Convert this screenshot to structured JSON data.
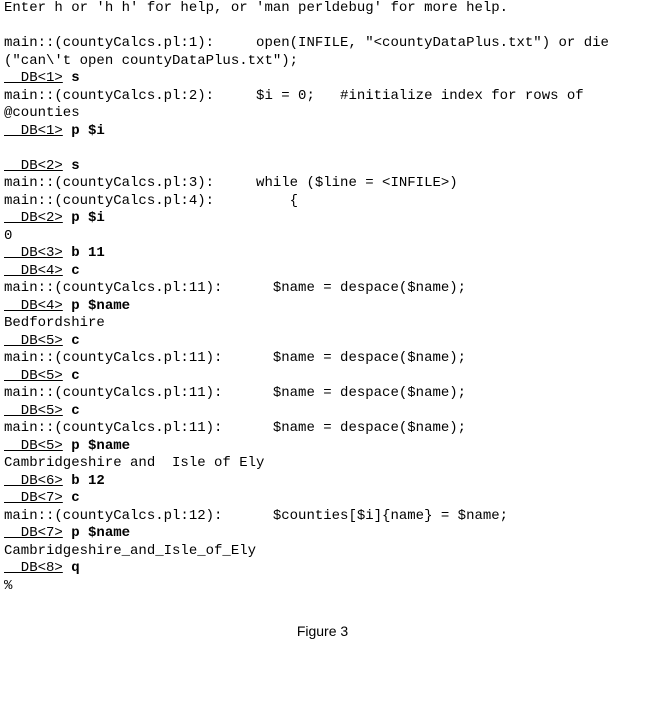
{
  "lines": [
    [
      {
        "t": "plain",
        "v": "Enter h or 'h h' for help, or 'man perldebug' for more help."
      }
    ],
    [
      {
        "t": "plain",
        "v": ""
      }
    ],
    [
      {
        "t": "plain",
        "v": "main::(countyCalcs.pl:1):     open(INFILE, \"<countyDataPlus.txt\") or die"
      }
    ],
    [
      {
        "t": "plain",
        "v": "(\"can\\'t open countyDataPlus.txt\");"
      }
    ],
    [
      {
        "t": "db",
        "v": "  DB<1>"
      },
      {
        "t": "plain",
        "v": " "
      },
      {
        "t": "cmd",
        "v": "s"
      }
    ],
    [
      {
        "t": "plain",
        "v": "main::(countyCalcs.pl:2):     $i = 0;   #initialize index for rows of"
      }
    ],
    [
      {
        "t": "plain",
        "v": "@counties"
      }
    ],
    [
      {
        "t": "db",
        "v": "  DB<1>"
      },
      {
        "t": "plain",
        "v": " "
      },
      {
        "t": "cmd",
        "v": "p $i"
      }
    ],
    [
      {
        "t": "plain",
        "v": ""
      }
    ],
    [
      {
        "t": "db",
        "v": "  DB<2>"
      },
      {
        "t": "plain",
        "v": " "
      },
      {
        "t": "cmd",
        "v": "s"
      }
    ],
    [
      {
        "t": "plain",
        "v": "main::(countyCalcs.pl:3):     while ($line = <INFILE>)"
      }
    ],
    [
      {
        "t": "plain",
        "v": "main::(countyCalcs.pl:4):         {"
      }
    ],
    [
      {
        "t": "db",
        "v": "  DB<2>"
      },
      {
        "t": "plain",
        "v": " "
      },
      {
        "t": "cmd",
        "v": "p $i"
      }
    ],
    [
      {
        "t": "plain",
        "v": "0"
      }
    ],
    [
      {
        "t": "db",
        "v": "  DB<3>"
      },
      {
        "t": "plain",
        "v": " "
      },
      {
        "t": "cmd",
        "v": "b 11"
      }
    ],
    [
      {
        "t": "db",
        "v": "  DB<4>"
      },
      {
        "t": "plain",
        "v": " "
      },
      {
        "t": "cmd",
        "v": "c"
      }
    ],
    [
      {
        "t": "plain",
        "v": "main::(countyCalcs.pl:11):      $name = despace($name);"
      }
    ],
    [
      {
        "t": "db",
        "v": "  DB<4>"
      },
      {
        "t": "plain",
        "v": " "
      },
      {
        "t": "cmd",
        "v": "p $name"
      }
    ],
    [
      {
        "t": "plain",
        "v": "Bedfordshire"
      }
    ],
    [
      {
        "t": "db",
        "v": "  DB<5>"
      },
      {
        "t": "plain",
        "v": " "
      },
      {
        "t": "cmd",
        "v": "c"
      }
    ],
    [
      {
        "t": "plain",
        "v": "main::(countyCalcs.pl:11):      $name = despace($name);"
      }
    ],
    [
      {
        "t": "db",
        "v": "  DB<5>"
      },
      {
        "t": "plain",
        "v": " "
      },
      {
        "t": "cmd",
        "v": "c"
      }
    ],
    [
      {
        "t": "plain",
        "v": "main::(countyCalcs.pl:11):      $name = despace($name);"
      }
    ],
    [
      {
        "t": "db",
        "v": "  DB<5>"
      },
      {
        "t": "plain",
        "v": " "
      },
      {
        "t": "cmd",
        "v": "c"
      }
    ],
    [
      {
        "t": "plain",
        "v": "main::(countyCalcs.pl:11):      $name = despace($name);"
      }
    ],
    [
      {
        "t": "db",
        "v": "  DB<5>"
      },
      {
        "t": "plain",
        "v": " "
      },
      {
        "t": "cmd",
        "v": "p $name"
      }
    ],
    [
      {
        "t": "plain",
        "v": "Cambridgeshire and  Isle of Ely"
      }
    ],
    [
      {
        "t": "db",
        "v": "  DB<6>"
      },
      {
        "t": "plain",
        "v": " "
      },
      {
        "t": "cmd",
        "v": "b 12"
      }
    ],
    [
      {
        "t": "db",
        "v": "  DB<7>"
      },
      {
        "t": "plain",
        "v": " "
      },
      {
        "t": "cmd",
        "v": "c"
      }
    ],
    [
      {
        "t": "plain",
        "v": "main::(countyCalcs.pl:12):      $counties[$i]{name} = $name;"
      }
    ],
    [
      {
        "t": "db",
        "v": "  DB<7>"
      },
      {
        "t": "plain",
        "v": " "
      },
      {
        "t": "cmd",
        "v": "p $name"
      }
    ],
    [
      {
        "t": "plain",
        "v": "Cambridgeshire_and_Isle_of_Ely"
      }
    ],
    [
      {
        "t": "db",
        "v": "  DB<8>"
      },
      {
        "t": "plain",
        "v": " "
      },
      {
        "t": "cmd",
        "v": "q"
      }
    ],
    [
      {
        "t": "plain",
        "v": "%"
      }
    ]
  ],
  "caption": "Figure 3"
}
